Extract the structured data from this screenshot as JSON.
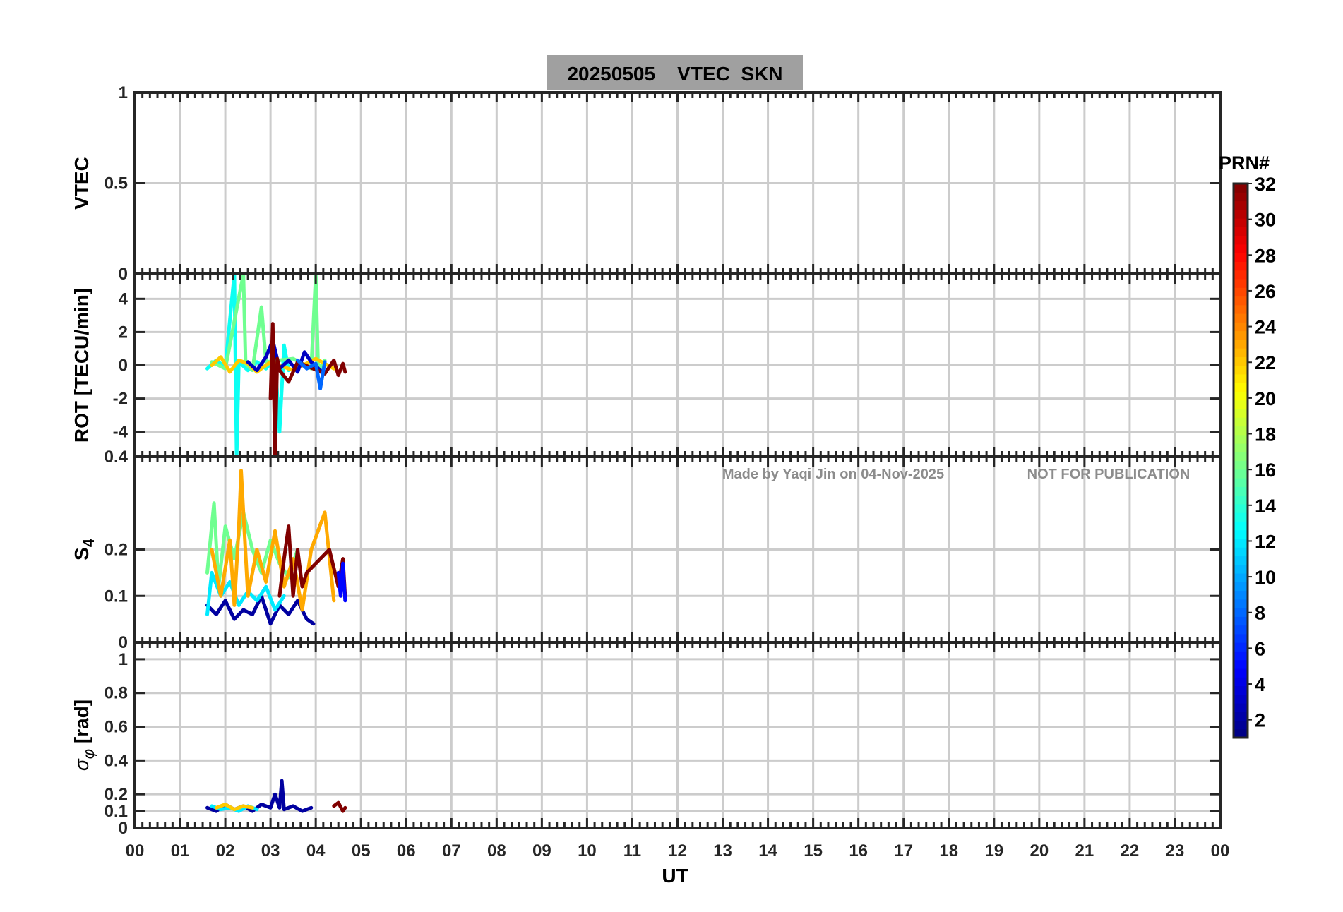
{
  "chart_data": {
    "type": "line",
    "title": "20250505    VTEC  SKN",
    "xlabel": "UT",
    "x_ticks": [
      "00",
      "01",
      "02",
      "03",
      "04",
      "05",
      "06",
      "07",
      "08",
      "09",
      "10",
      "11",
      "12",
      "13",
      "14",
      "15",
      "16",
      "17",
      "18",
      "19",
      "20",
      "21",
      "22",
      "23",
      "00"
    ],
    "xlim": [
      0,
      24
    ],
    "grid": true,
    "watermark_left": "Made by Yaqi Jin on 04-Nov-2025",
    "watermark_right": "NOT FOR PUBLICATION",
    "colorbar": {
      "title": "PRN#",
      "ticks": [
        "2",
        "4",
        "6",
        "8",
        "10",
        "12",
        "14",
        "16",
        "18",
        "20",
        "22",
        "24",
        "26",
        "28",
        "30",
        "32"
      ],
      "range": [
        1,
        32
      ],
      "colormap": "jet"
    },
    "panels": [
      {
        "id": "vtec",
        "ylabel": "VTEC",
        "ylim": [
          0,
          1
        ],
        "y_ticks": [
          0,
          0.5,
          1
        ],
        "y_tick_labels": [
          "0",
          "0.5",
          "1"
        ],
        "series": []
      },
      {
        "id": "rot",
        "ylabel": "ROT [TECU/min]",
        "ylim": [
          -5.5,
          5.5
        ],
        "y_ticks": [
          -4,
          -2,
          0,
          2,
          4
        ],
        "y_tick_labels": [
          "-4",
          "-2",
          "0",
          "2",
          "4"
        ],
        "series": [
          {
            "prn": 13,
            "x": [
              1.6,
              1.8,
              2.0,
              2.2,
              2.25,
              2.3,
              2.5,
              2.7,
              2.9,
              3.1,
              3.2,
              3.3,
              3.4
            ],
            "y": [
              -0.2,
              0.3,
              -0.1,
              5.5,
              -5.5,
              0.2,
              -0.3,
              0.2,
              -0.2,
              0.4,
              -4.0,
              1.2,
              -0.3
            ]
          },
          {
            "prn": 16,
            "x": [
              1.7,
              2.0,
              2.4,
              2.45,
              2.6,
              2.8,
              2.9,
              3.5,
              3.9,
              4.0,
              4.05,
              4.1,
              4.2
            ],
            "y": [
              0.2,
              -0.2,
              5.5,
              0.1,
              -0.3,
              3.5,
              0.2,
              0.4,
              -0.2,
              5.5,
              0.1,
              -0.2,
              0.3
            ]
          },
          {
            "prn": 22,
            "x": [
              1.7,
              1.9,
              2.1,
              2.3,
              2.5,
              2.7,
              3.0,
              3.5,
              4.0,
              4.4
            ],
            "y": [
              0.0,
              0.5,
              -0.4,
              0.3,
              0.1,
              -0.4,
              0.2,
              -0.3,
              0.4,
              -0.2
            ]
          },
          {
            "prn": 3,
            "x": [
              2.5,
              2.7,
              2.9,
              3.05,
              3.2,
              3.4,
              3.6,
              3.75,
              3.9,
              4.1
            ],
            "y": [
              0.2,
              -0.3,
              0.5,
              1.5,
              -0.2,
              0.3,
              -0.4,
              0.8,
              0.2,
              -0.3
            ]
          },
          {
            "prn": 32,
            "x": [
              3.0,
              3.05,
              3.1,
              3.15,
              3.2,
              3.4,
              3.6,
              4.2,
              4.4,
              4.5,
              4.6,
              4.65
            ],
            "y": [
              -2.0,
              2.5,
              -5.5,
              0.4,
              -0.3,
              -1.0,
              0.2,
              -0.5,
              0.3,
              -0.6,
              0.1,
              -0.4
            ]
          },
          {
            "prn": 8,
            "x": [
              3.6,
              3.8,
              4.0,
              4.1,
              4.2
            ],
            "y": [
              0.3,
              -0.2,
              0.1,
              -1.4,
              0.2
            ]
          }
        ]
      },
      {
        "id": "s4",
        "ylabel": "S4",
        "ylim": [
          0,
          0.4
        ],
        "y_ticks": [
          0,
          0.1,
          0.2
        ],
        "y_tick_labels": [
          "0",
          "0.1",
          "0.2"
        ],
        "extra_top_label": "0.4",
        "series": [
          {
            "prn": 2,
            "x": [
              1.6,
              1.8,
              2.0,
              2.2,
              2.4,
              2.6,
              2.8,
              3.0,
              3.2,
              3.4,
              3.6,
              3.8,
              3.95
            ],
            "y": [
              0.08,
              0.06,
              0.09,
              0.05,
              0.07,
              0.06,
              0.1,
              0.04,
              0.08,
              0.06,
              0.09,
              0.05,
              0.04
            ]
          },
          {
            "prn": 12,
            "x": [
              1.6,
              1.7,
              1.9,
              2.1,
              2.3,
              2.5,
              2.7,
              2.9,
              3.1,
              3.3
            ],
            "y": [
              0.06,
              0.15,
              0.1,
              0.13,
              0.08,
              0.11,
              0.09,
              0.12,
              0.07,
              0.1
            ]
          },
          {
            "prn": 16,
            "x": [
              1.6,
              1.75,
              1.85,
              2.0,
              2.2,
              2.4,
              2.6,
              2.8,
              3.0,
              3.2,
              3.4,
              3.6
            ],
            "y": [
              0.15,
              0.3,
              0.12,
              0.25,
              0.18,
              0.28,
              0.2,
              0.15,
              0.22,
              0.17,
              0.14,
              0.2
            ]
          },
          {
            "prn": 23,
            "x": [
              1.7,
              1.9,
              2.1,
              2.2,
              2.3,
              2.35,
              2.5,
              2.7,
              2.9,
              3.1,
              3.3,
              3.5,
              3.7,
              3.9,
              4.2,
              4.4
            ],
            "y": [
              0.2,
              0.1,
              0.22,
              0.08,
              0.25,
              0.37,
              0.1,
              0.2,
              0.13,
              0.24,
              0.12,
              0.18,
              0.07,
              0.2,
              0.28,
              0.09
            ]
          },
          {
            "prn": 32,
            "x": [
              3.2,
              3.3,
              3.4,
              3.5,
              3.6,
              3.7,
              3.8,
              4.3,
              4.5,
              4.6,
              4.65
            ],
            "y": [
              0.1,
              0.18,
              0.25,
              0.1,
              0.2,
              0.12,
              0.15,
              0.2,
              0.12,
              0.18,
              0.1
            ]
          },
          {
            "prn": 5,
            "x": [
              4.5,
              4.55,
              4.6,
              4.65
            ],
            "y": [
              0.15,
              0.1,
              0.17,
              0.09
            ]
          }
        ]
      },
      {
        "id": "sigma",
        "ylabel": "σ φ [rad]",
        "ylim": [
          0,
          1.1
        ],
        "y_ticks": [
          0,
          0.1,
          0.2,
          0.4,
          0.6,
          0.8,
          1
        ],
        "y_tick_labels": [
          "0",
          "0.1",
          "0.2",
          "0.4",
          "0.6",
          "0.8",
          "1"
        ],
        "series": [
          {
            "prn": 2,
            "x": [
              1.6,
              1.8,
              2.0,
              2.2,
              2.4,
              2.6,
              2.8,
              3.0,
              3.1,
              3.2,
              3.25,
              3.3,
              3.5,
              3.7,
              3.9
            ],
            "y": [
              0.12,
              0.1,
              0.14,
              0.11,
              0.13,
              0.1,
              0.14,
              0.12,
              0.2,
              0.12,
              0.28,
              0.11,
              0.13,
              0.1,
              0.12
            ]
          },
          {
            "prn": 12,
            "x": [
              1.7,
              1.9,
              2.1,
              2.3,
              2.5,
              2.7
            ],
            "y": [
              0.13,
              0.11,
              0.12,
              0.1,
              0.13,
              0.11
            ]
          },
          {
            "prn": 22,
            "x": [
              1.8,
              2.0,
              2.2,
              2.4,
              2.6
            ],
            "y": [
              0.12,
              0.14,
              0.11,
              0.13,
              0.12
            ]
          },
          {
            "prn": 32,
            "x": [
              4.4,
              4.5,
              4.6,
              4.65
            ],
            "y": [
              0.13,
              0.15,
              0.1,
              0.12
            ]
          }
        ]
      }
    ]
  }
}
